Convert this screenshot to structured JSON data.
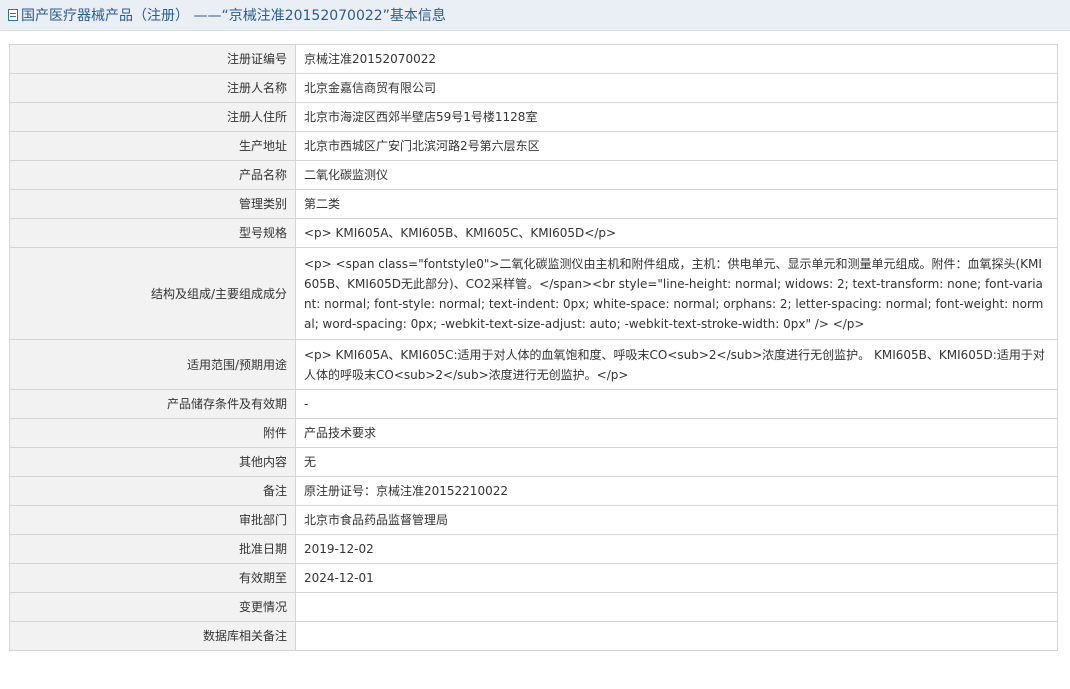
{
  "header": {
    "title": "国产医疗器械产品（注册） ——“京械注准20152070022”基本信息"
  },
  "rows": [
    {
      "label": "注册证编号",
      "value": "京械注准20152070022"
    },
    {
      "label": "注册人名称",
      "value": "北京金嘉信商贸有限公司"
    },
    {
      "label": "注册人住所",
      "value": "北京市海淀区西郊半壁店59号1号楼1128室"
    },
    {
      "label": "生产地址",
      "value": "北京市西城区广安门北滨河路2号第六层东区"
    },
    {
      "label": "产品名称",
      "value": "二氧化碳监测仪"
    },
    {
      "label": "管理类别",
      "value": "第二类"
    },
    {
      "label": "型号规格",
      "value": "<p> KMI605A、KMI605B、KMI605C、KMI605D</p>"
    },
    {
      "label": "结构及组成/主要组成成分",
      "value": "<p> <span class=\"fontstyle0\">二氧化碳监测仪由主机和附件组成，主机：供电单元、显示单元和测量单元组成。附件：血氧探头(KMI605B、KMI605D无此部分)、CO2采样管。</span><br style=\"line-height: normal; widows: 2; text-transform: none; font-variant: normal; font-style: normal; text-indent: 0px; white-space: normal; orphans: 2; letter-spacing: normal; font-weight: normal; word-spacing: 0px; -webkit-text-size-adjust: auto; -webkit-text-stroke-width: 0px\" /> </p>"
    },
    {
      "label": "适用范围/预期用途",
      "value": "<p> KMI605A、KMI605C:适用于对人体的血氧饱和度、呼吸末CO<sub>2</sub>浓度进行无创监护。 KMI605B、KMI605D:适用于对人体的呼吸末CO<sub>2</sub>浓度进行无创监护。</p>"
    },
    {
      "label": "产品储存条件及有效期",
      "value": "-"
    },
    {
      "label": "附件",
      "value": "产品技术要求"
    },
    {
      "label": "其他内容",
      "value": "无"
    },
    {
      "label": "备注",
      "value": "原注册证号：京械注准20152210022"
    },
    {
      "label": "审批部门",
      "value": "北京市食品药品监督管理局"
    },
    {
      "label": "批准日期",
      "value": "2019-12-02"
    },
    {
      "label": "有效期至",
      "value": "2024-12-01"
    },
    {
      "label": "变更情况",
      "value": ""
    },
    {
      "label": "数据库相关备注",
      "value": ""
    }
  ]
}
